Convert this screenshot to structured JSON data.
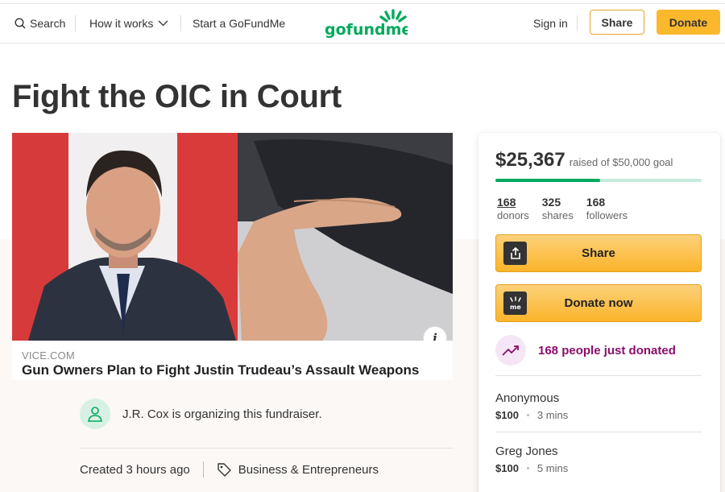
{
  "header": {
    "search_label": "Search",
    "how_it_works_label": "How it works",
    "start_label": "Start a GoFundMe",
    "logo_text": "gofundme",
    "signin_label": "Sign in",
    "share_label": "Share",
    "donate_label": "Donate"
  },
  "colors": {
    "brand_green": "#02a95c",
    "accent_yellow": "#fbb82d",
    "recent_purple": "#8a0e6b"
  },
  "campaign": {
    "title": "Fight the OIC in Court",
    "media": {
      "domain": "VICE.COM",
      "headline": "Gun Owners Plan to Fight Justin Trudeau’s Assault Weapons"
    },
    "organizer_text": "J.R. Cox is organizing this fundraiser.",
    "created": "Created 3 hours ago",
    "category": "Business & Entrepreneurs"
  },
  "sidebar": {
    "raised": "$25,367",
    "goal_text": "raised of $50,000 goal",
    "progress_fraction": 0.507,
    "stats": {
      "donors_num": "168",
      "donors_lbl": "donors",
      "shares_num": "325",
      "shares_lbl": "shares",
      "followers_num": "168",
      "followers_lbl": "followers"
    },
    "share_label": "Share",
    "donate_label": "Donate now",
    "recent_text": "168 people just donated",
    "donations": [
      {
        "name": "Anonymous",
        "amount": "$100",
        "time": "3 mins"
      },
      {
        "name": "Greg Jones",
        "amount": "$100",
        "time": "5 mins"
      }
    ]
  }
}
